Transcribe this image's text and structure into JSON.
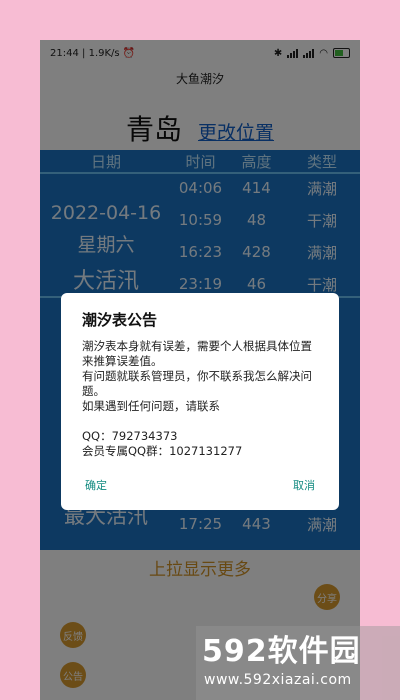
{
  "statusbar": {
    "time": "21:44",
    "speed": "1.9K/s"
  },
  "app": {
    "title": "大鱼潮汐"
  },
  "location": {
    "city": "青岛",
    "change": "更改位置"
  },
  "table": {
    "headers": [
      "日期",
      "时间",
      "高度",
      "类型"
    ],
    "day1": {
      "date": "2022-04-16",
      "weekday": "星期六",
      "tide_desc": "大活汛",
      "rows": [
        {
          "time": "04:06",
          "height": "414",
          "type": "满潮"
        },
        {
          "time": "10:59",
          "height": "48",
          "type": "干潮"
        },
        {
          "time": "16:23",
          "height": "428",
          "type": "满潮"
        },
        {
          "time": "23:19",
          "height": "46",
          "type": "干潮"
        }
      ]
    },
    "day2": {
      "tide_desc": "最大活汛",
      "row": {
        "time": "17:25",
        "height": "443",
        "type": "满潮"
      }
    }
  },
  "pull_more": "上拉显示更多",
  "buttons": {
    "share": "分享",
    "feedback": "反馈",
    "notice": "公告"
  },
  "dialog": {
    "title": "潮汐表公告",
    "lines": [
      "潮汐表本身就有误差，需要个人根据具体位置来推算误差值。",
      "有问题就联系管理员，你不联系我怎么解决问题。",
      "如果遇到任何问题，请联系",
      "",
      "QQ：792734373",
      "会员专属QQ群：1027131277"
    ],
    "ok": "确定",
    "cancel": "取消"
  },
  "watermark": {
    "logo": "592软件园",
    "url": "www.592xiazai.com"
  }
}
